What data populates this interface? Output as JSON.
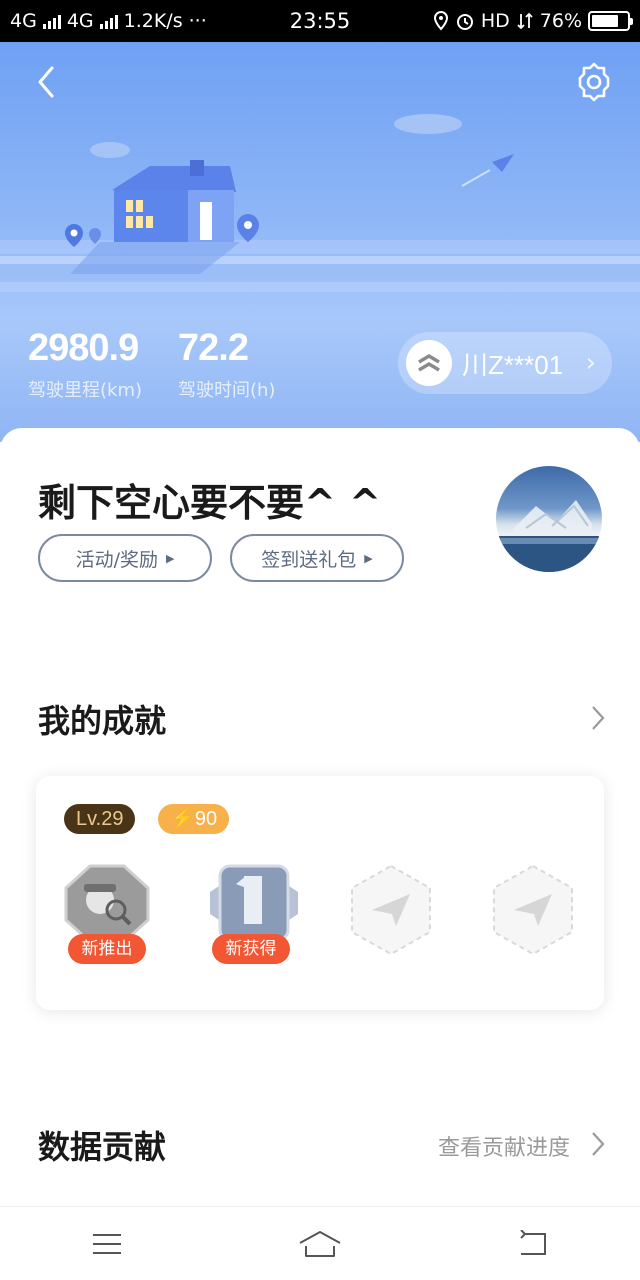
{
  "status_bar": {
    "network1": "4G",
    "network2": "4G",
    "speed": "1.2K/s",
    "dots": "···",
    "time": "23:55",
    "hd": "HD",
    "battery": "76%",
    "battery_level": 0.76
  },
  "header": {
    "mileage_value": "2980.9",
    "mileage_label": "驾驶里程(km)",
    "time_value": "72.2",
    "time_label": "驾驶时间(h)",
    "plate": "川Z***01"
  },
  "profile": {
    "username": "剩下空心要不要^ ^",
    "btn_activity": "活动/奖励",
    "btn_signin": "签到送礼包"
  },
  "achievements": {
    "title": "我的成就",
    "level": "Lv.29",
    "points": "90",
    "medals": [
      {
        "tag": "新推出",
        "icon": "detective-medal-icon"
      },
      {
        "tag": "新获得",
        "icon": "number-one-medal-icon"
      },
      {
        "tag": "",
        "icon": "locked-plane-medal-icon"
      },
      {
        "tag": "",
        "icon": "locked-plane-medal-icon"
      }
    ]
  },
  "data_contribution": {
    "title": "数据贡献",
    "link": "查看贡献进度"
  },
  "colors": {
    "header_blue": "#8fb7f7",
    "tag_red": "#f25633",
    "level_brown": "#4a3417",
    "points_orange": "#f7b04a"
  }
}
